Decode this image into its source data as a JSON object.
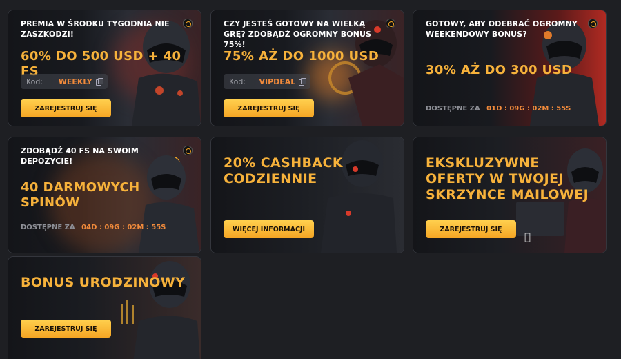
{
  "cards": [
    {
      "small_title": "PREMIA W ŚRODKU TYGODNIA NIE ZASZKODZI!",
      "big_title": "60% DO 500 USD + 40 FS",
      "code_label": "Kod:",
      "code": "WEEKLY",
      "button": "ZAREJESTRUJ SIĘ"
    },
    {
      "small_title": "CZY JESTEŚ GOTOWY NA WIELKĄ GRĘ? ZDOBĄDŹ OGROMNY BONUS 75%!",
      "big_title": "75% AŻ DO 1000 USD",
      "code_label": "Kod:",
      "code": "VIPDEAL",
      "button": "ZAREJESTRUJ SIĘ"
    },
    {
      "small_title": "GOTOWY, ABY ODEBRAĆ OGROMNY WEEKENDOWY BONUS?",
      "big_title": "30% AŻ DO 300 USD",
      "countdown_label": "DOSTĘPNE ZA",
      "countdown": "01D : 09G : 02M : 55S"
    },
    {
      "small_title": "ZDOBĄDŹ 40 FS NA SWOIM DEPOZYCIE!",
      "big_title": "40 DARMOWYCH SPINÓW",
      "countdown_label": "DOSTĘPNE ZA",
      "countdown": "04D : 09G : 02M : 55S"
    },
    {
      "big_title": "20% CASHBACK CODZIENNIE",
      "button": "WIĘCEJ INFORMACJI"
    },
    {
      "big_title": "EKSKLUZYWNE OFERTY W TWOJEJ SKRZYNCE MAILOWEJ",
      "button": "ZAREJESTRUJ SIĘ"
    },
    {
      "big_title": "BONUS URODZINOWY",
      "button": "ZAREJESTRUJ SIĘ"
    }
  ],
  "colors": {
    "background": "#1e1f23",
    "accent_gold": "#f7b23b",
    "accent_orange": "#f08a3b",
    "button_top": "#ffd04e",
    "button_bottom": "#f5a524"
  },
  "icons": [
    "copy-icon",
    "coin-badge-icon",
    "apple-icon"
  ]
}
